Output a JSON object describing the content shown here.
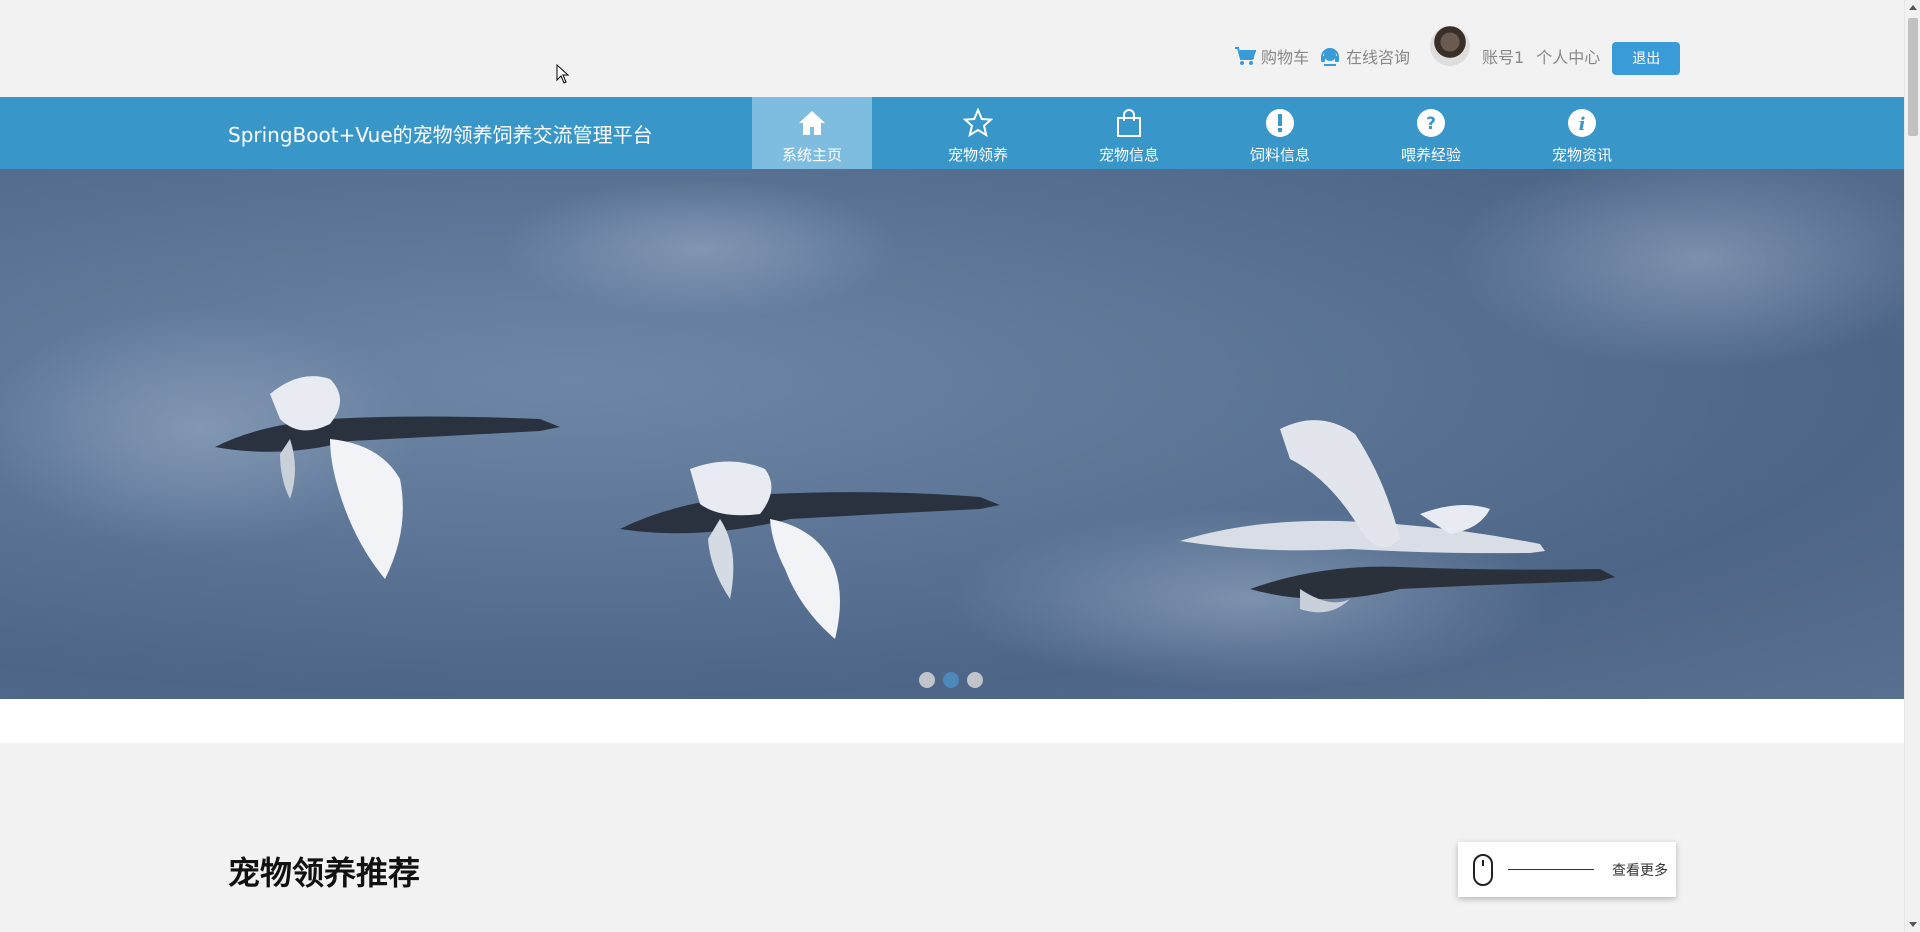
{
  "topbar": {
    "cart_label": "购物车",
    "consult_label": "在线咨询",
    "account_label": "账号1",
    "center_label": "个人中心",
    "logout_label": "退出"
  },
  "nav": {
    "brand": "SpringBoot+Vue的宠物领养饲养交流管理平台",
    "items": [
      {
        "label": "系统主页",
        "icon": "home-icon",
        "active": true
      },
      {
        "label": "宠物领养",
        "icon": "star-icon",
        "active": false
      },
      {
        "label": "宠物信息",
        "icon": "bag-icon",
        "active": false
      },
      {
        "label": "饲料信息",
        "icon": "exclamation-icon",
        "active": false
      },
      {
        "label": "喂养经验",
        "icon": "question-icon",
        "active": false
      },
      {
        "label": "宠物资讯",
        "icon": "info-icon",
        "active": false
      }
    ]
  },
  "banner": {
    "slide_count": 3,
    "active_slide": 2
  },
  "section": {
    "title": "宠物领养推荐",
    "more_label": "查看更多"
  },
  "colors": {
    "nav_bg": "#3996c9",
    "nav_active": "#7fbde0",
    "accent": "#3a9bd9"
  }
}
